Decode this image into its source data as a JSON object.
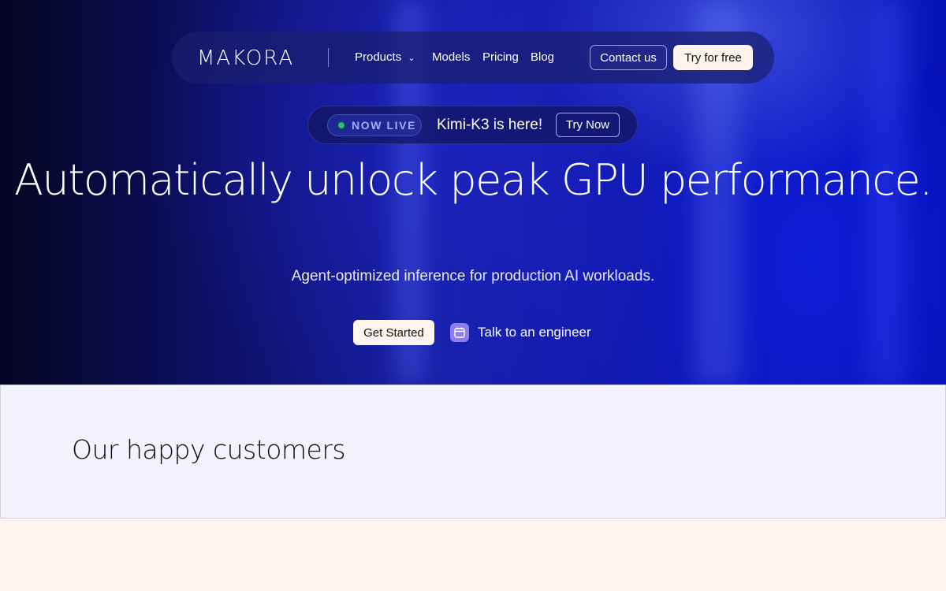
{
  "nav": {
    "logo": "MAKORA",
    "links": [
      "Products",
      "Models",
      "Pricing",
      "Blog"
    ],
    "contact_label": "Contact us",
    "try_label": "Try for free"
  },
  "announcement": {
    "badge": "NOW LIVE",
    "text": "Kimi-K3 is here!",
    "cta": "Try Now"
  },
  "hero": {
    "headline": "Automatically unlock peak GPU performance.",
    "subheadline": "Agent-optimized inference for production AI workloads.",
    "primary_cta": "Get Started",
    "secondary_cta": "Talk to an engineer"
  },
  "customers": {
    "title": "Our happy customers"
  },
  "colors": {
    "hero_bg": "#0f18b6",
    "cream": "#fff4ee",
    "live_dot": "#22c55e",
    "customers_bg": "#f3f3fe"
  },
  "icons": [
    "chevron-down-icon",
    "status-dot-icon",
    "calendar-icon"
  ]
}
